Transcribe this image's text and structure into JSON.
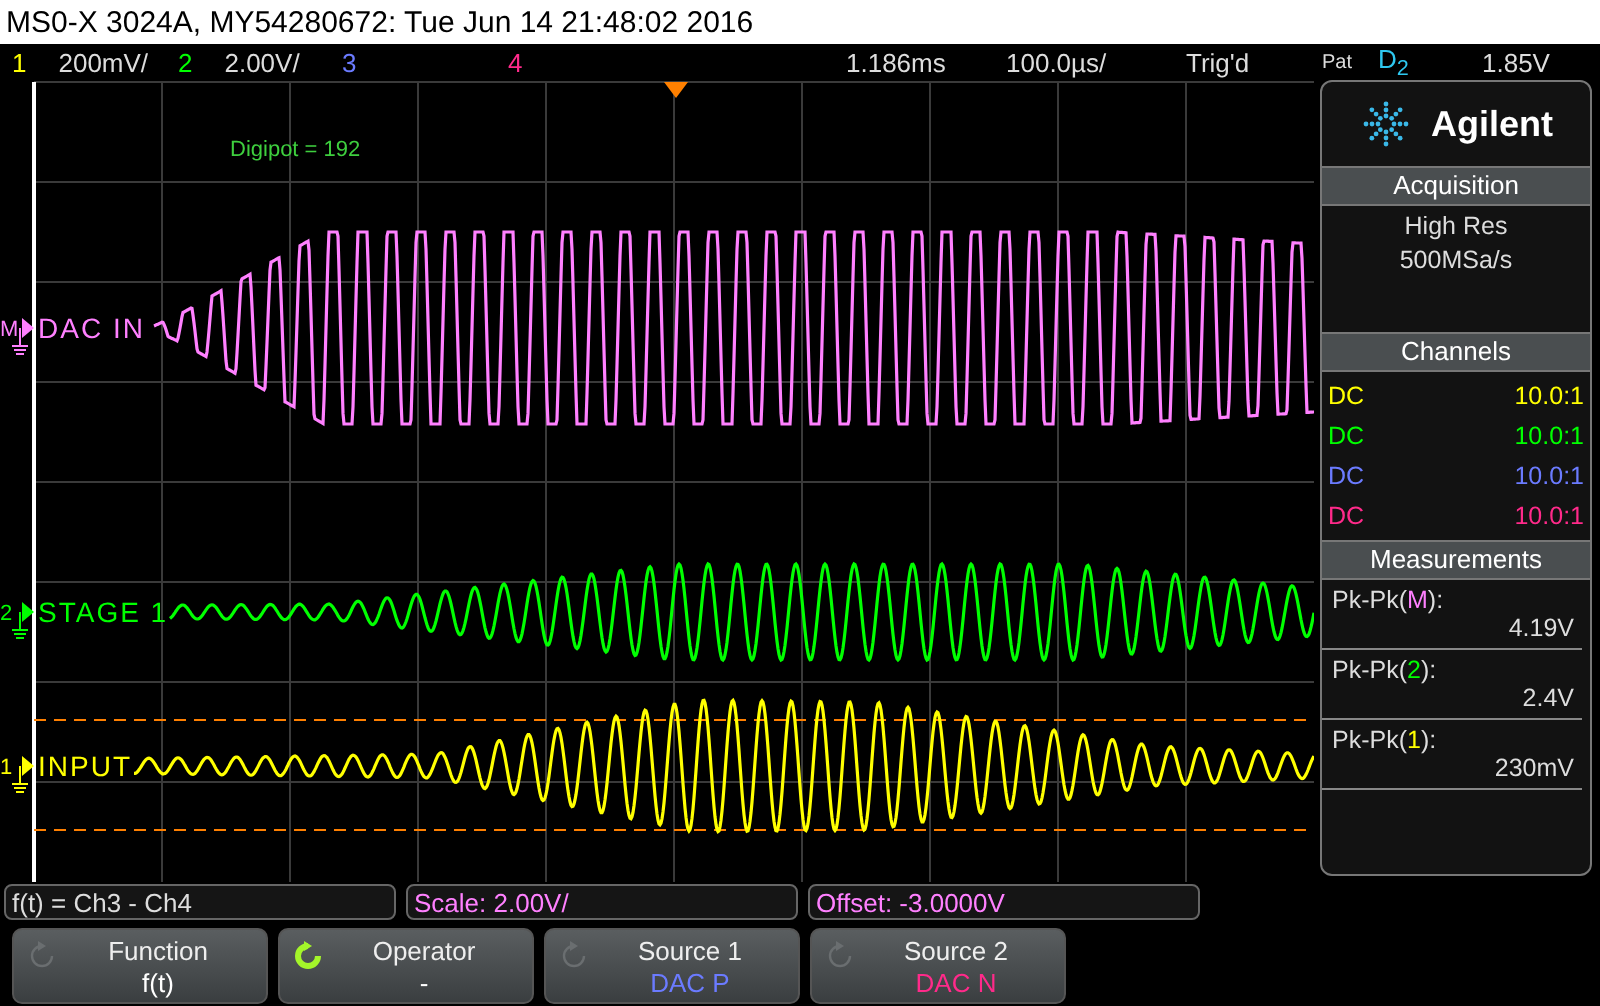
{
  "title_bar": {
    "text": "MS0-X 3024A, MY54280672: Tue Jun 14 21:48:02 2016"
  },
  "channel_bar": {
    "channels": [
      {
        "number": "1",
        "color": "#ffff00",
        "scale": "200mV/"
      },
      {
        "number": "2",
        "color": "#00ff00",
        "scale": "2.00V/"
      },
      {
        "number": "3",
        "color": "#6b7bff"
      },
      {
        "number": "4",
        "color": "#ff2a8a"
      }
    ],
    "delay": "1.186ms",
    "timebase": "100.0µs/",
    "status": "Trig'd",
    "trigger_mode": "Pat",
    "trigger_source": "D",
    "trigger_source_sub": "2",
    "trigger_level": "1.85V"
  },
  "graticule": {
    "annotation": "Digipot = 192",
    "traces": [
      {
        "marker": "M",
        "label": "DAC IN",
        "color": "#ff80ff",
        "kind": "square"
      },
      {
        "marker": "2",
        "label": "STAGE 1",
        "color": "#00ff00",
        "kind": "sine"
      },
      {
        "marker": "1",
        "label": "INPUT",
        "color": "#ffff00",
        "kind": "sine"
      }
    ]
  },
  "side_panel": {
    "brand": "Agilent",
    "acquisition": {
      "header": "Acquisition",
      "mode": "High Res",
      "rate": "500MSa/s"
    },
    "channels": {
      "header": "Channels",
      "rows": [
        {
          "coupling": "DC",
          "probe": "10.0:1",
          "color": "#ffff00"
        },
        {
          "coupling": "DC",
          "probe": "10.0:1",
          "color": "#00ff00"
        },
        {
          "coupling": "DC",
          "probe": "10.0:1",
          "color": "#6b7bff"
        },
        {
          "coupling": "DC",
          "probe": "10.0:1",
          "color": "#ff2a8a"
        }
      ]
    },
    "measurements": {
      "header": "Measurements",
      "items": [
        {
          "prefix": "Pk-Pk(",
          "source": "M",
          "suffix": "):",
          "value": "4.19V",
          "color": "#ff80ff"
        },
        {
          "prefix": "Pk-Pk(",
          "source": "2",
          "suffix": "):",
          "value": "2.4V",
          "color": "#00ff00"
        },
        {
          "prefix": "Pk-Pk(",
          "source": "1",
          "suffix": "):",
          "value": "230mV",
          "color": "#ffff00"
        }
      ]
    }
  },
  "function_bar": {
    "expression": "f(t) = Ch3 - Ch4",
    "scale": "Scale: 2.00V/",
    "offset": "Offset: -3.0000V"
  },
  "softkeys": [
    {
      "label": "Function",
      "value": "f(t)",
      "active": false,
      "color": "#ffffff"
    },
    {
      "label": "Operator",
      "value": "-",
      "active": true,
      "color": "#ffffff"
    },
    {
      "label": "Source 1",
      "value": "DAC  P",
      "active": false,
      "color": "#6b7bff"
    },
    {
      "label": "Source 2",
      "value": "DAC  N",
      "active": false,
      "color": "#ff2a8a"
    }
  ]
}
